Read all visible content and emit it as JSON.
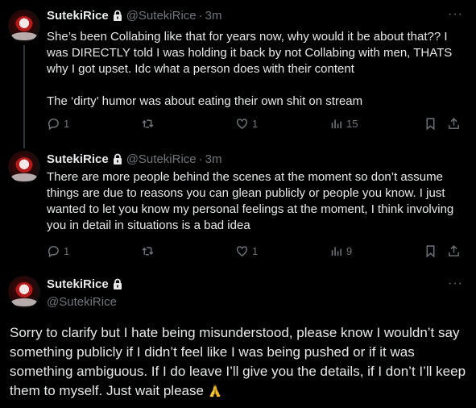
{
  "tweets": [
    {
      "name": "SutekiRice",
      "handle": "@SutekiRice",
      "time": "3m",
      "text": "She’s been Collabing like that for years now, why would it be about that?? I was DIRECTLY told I was holding it back by not Collabing with men, THATS why I got upset. Idc what a person does with their content\n\nThe ‘dirty’ humor was about eating their own shit on stream",
      "replies": "1",
      "likes": "1",
      "views": "15"
    },
    {
      "name": "SutekiRice",
      "handle": "@SutekiRice",
      "time": "3m",
      "text": "There are more people behind the scenes at the moment so don’t assume things are due to reasons you can glean publicly or people you know. I just wanted to let you know my personal feelings at the moment, I think involving you in detail in situations is a bad idea",
      "replies": "1",
      "likes": "1",
      "views": "9"
    }
  ],
  "main_tweet": {
    "name": "SutekiRice",
    "handle": "@SutekiRice",
    "text": "Sorry to clarify but I hate being misunderstood, please know I wouldn’t say something publicly if I didn’t feel like I was being pushed or if it was something ambiguous. If I do leave I’ll give you the details, if I don’t I’ll keep them to myself. Just wait please",
    "emoji": "folded-hands"
  },
  "more_label": "···",
  "dot": "·",
  "icons": {
    "reply": "reply-icon",
    "retweet": "retweet-icon",
    "like": "like-icon",
    "views": "views-icon",
    "bookmark": "bookmark-icon",
    "share": "share-icon",
    "lock": "lock-icon"
  },
  "colors": {
    "background": "#000000",
    "text": "#e7e9ea",
    "secondary": "#71767b",
    "divider": "#2f3336"
  }
}
